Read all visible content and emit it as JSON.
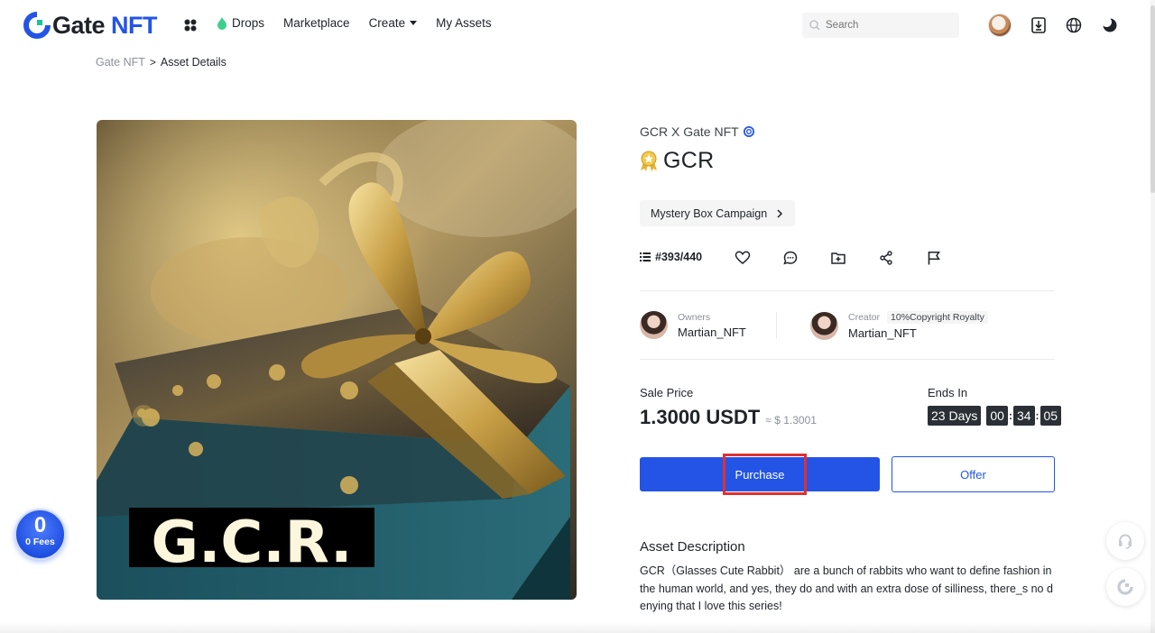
{
  "header": {
    "logo_gate": "Gate",
    "logo_nft": "NFT",
    "nav": {
      "drops": "Drops",
      "marketplace": "Marketplace",
      "create": "Create",
      "my_assets": "My Assets"
    },
    "search_placeholder": "Search"
  },
  "breadcrumb": {
    "home": "Gate NFT",
    "separator": ">",
    "current": "Asset Details"
  },
  "artwork": {
    "overlay_text": "G.C.R."
  },
  "asset": {
    "collection": "GCR X Gate NFT",
    "title": "GCR",
    "campaign": "Mystery Box Campaign",
    "edition": "#393/440"
  },
  "owners": {
    "label": "Owners",
    "name": "Martian_NFT"
  },
  "creator": {
    "label": "Creator",
    "royalty": "10%Copyright Royalty",
    "name": "Martian_NFT"
  },
  "sale": {
    "label": "Sale Price",
    "price": "1.3000 USDT",
    "usd": "≈ $ 1.3001"
  },
  "ends": {
    "label": "Ends In",
    "days": "23 Days",
    "hours": "00",
    "minutes": "34",
    "seconds": "05",
    "colon": ":"
  },
  "buttons": {
    "purchase": "Purchase",
    "offer": "Offer"
  },
  "description": {
    "title": "Asset Description",
    "text": "GCR（Glasses Cute Rabbit） are a bunch of rabbits who want to define fashion in the human world, and yes, they do and with an extra dose of silliness, there_s no denying that I love this series!"
  },
  "fees_badge": {
    "number": "0",
    "label": "0 Fees"
  },
  "colors": {
    "accent": "#2354e6",
    "highlight": "#e0302e",
    "timer_bg": "#2b2f36"
  }
}
